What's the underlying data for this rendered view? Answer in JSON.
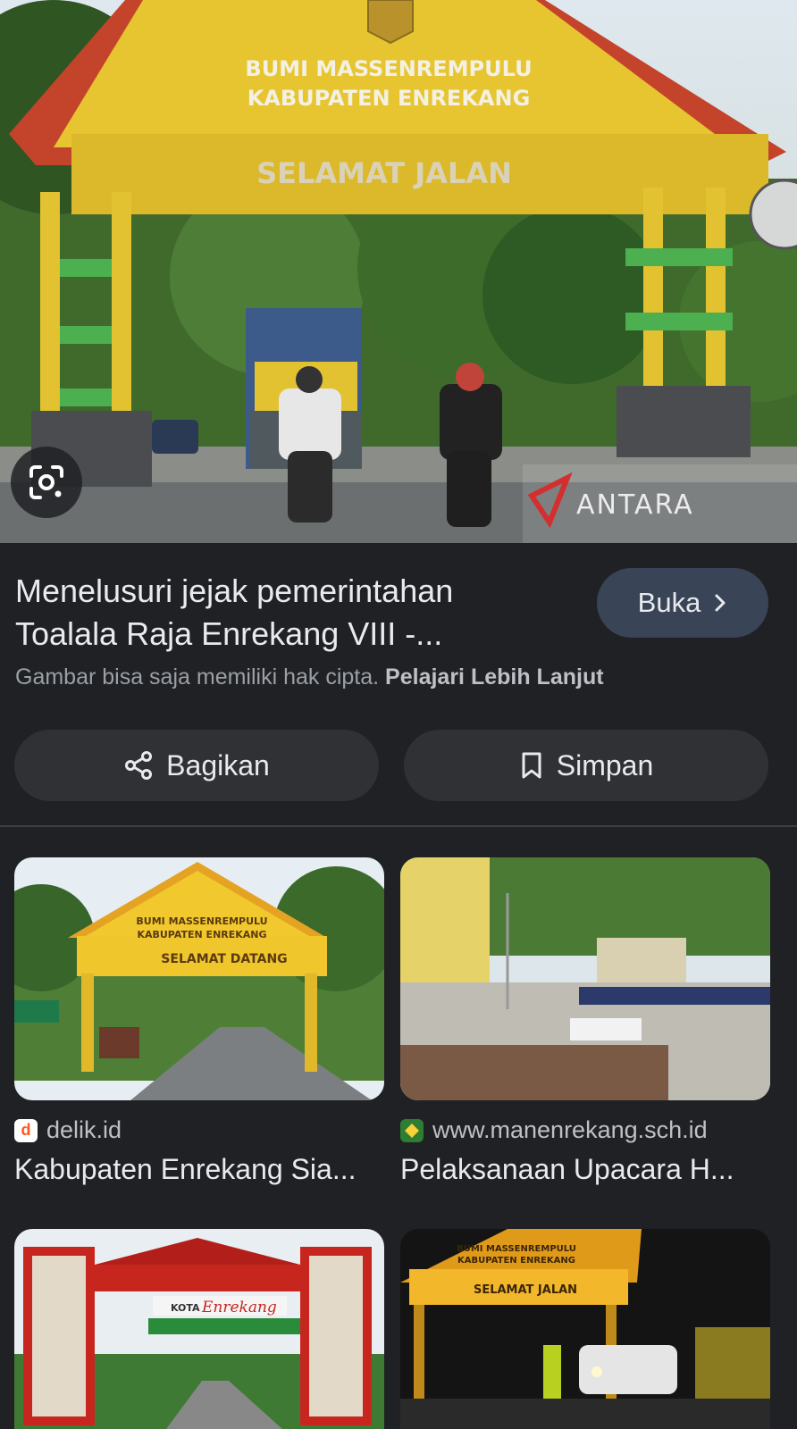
{
  "hero": {
    "sign_line1": "BUMI MASSENREMPULU",
    "sign_line2": "KABUPATEN ENREKANG",
    "sign_line3": "SELAMAT JALAN",
    "watermark": "ANTARA"
  },
  "result": {
    "title_line1": "Menelusuri jejak pemerintahan",
    "title_line2": "Toalala Raja Enrekang VIII -...",
    "open_label": "Buka",
    "copyright_text": "Gambar bisa saja memiliki hak cipta.",
    "learn_more": "Pelajari Lebih Lanjut"
  },
  "actions": {
    "share_label": "Bagikan",
    "save_label": "Simpan"
  },
  "related": [
    {
      "source": "delik.id",
      "title": "Kabupaten Enrekang Sia...",
      "sign_line1": "BUMI MASSENREMPULU",
      "sign_line2": "KABUPATEN ENREKANG",
      "sign_line3": "SELAMAT DATANG",
      "favicon_letter": "d",
      "favicon_color": "#ff5722"
    },
    {
      "source": "www.manenrekang.sch.id",
      "title": "Pelaksanaan Upacara H...",
      "favicon_color": "#2e7d32"
    },
    {
      "sign_line1": "KOTA",
      "sign_line2": "Enrekang"
    },
    {
      "sign_line1": "BUMI MASSENREMPULU",
      "sign_line2": "KABUPATEN ENREKANG",
      "sign_line3": "SELAMAT JALAN"
    }
  ]
}
